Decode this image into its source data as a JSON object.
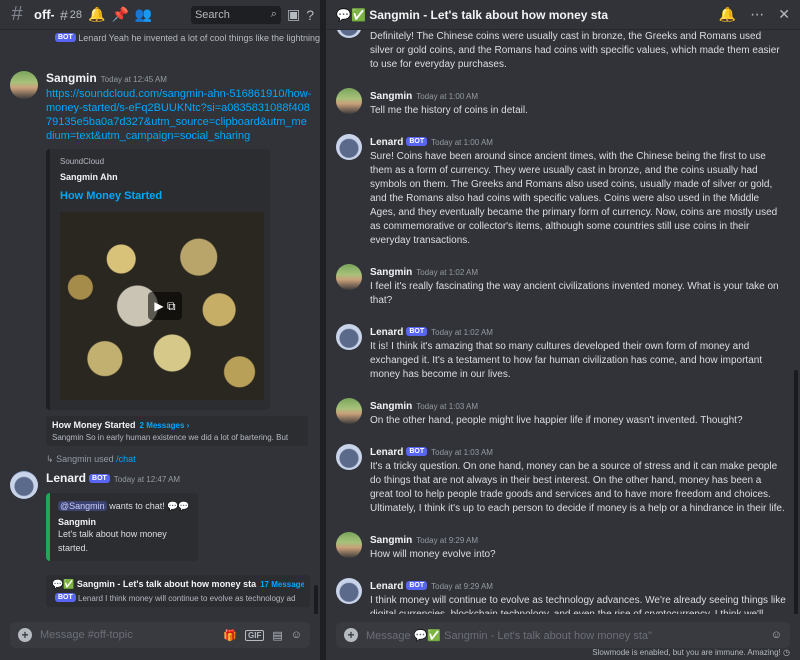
{
  "left": {
    "channel": "off-t",
    "thread_count": "28",
    "search_placeholder": "Search",
    "top_snippet_bot": "BOT",
    "top_snippet_author": "Lenard",
    "top_snippet_text": "Yeah he invented a lot of cool things like the lightning",
    "messages": [
      {
        "author": "Sangmin",
        "time": "Today at 12:45 AM",
        "link": "https://soundcloud.com/sangmin-ahn-516861910/how-money-started/s-eFq2BUUKNtc?si=a0835831088f40879135e5ba0a7d327&utm_source=clipboard&utm_medium=text&utm_campaign=social_sharing",
        "embed": {
          "provider": "SoundCloud",
          "author": "Sangmin Ahn",
          "title": "How Money Started"
        },
        "thread": {
          "title": "How Money Started",
          "count": "2 Messages ›",
          "last": "Sangmin So in early human existence we did a lot of bartering. But"
        }
      }
    ],
    "system": {
      "user": "Sangmin",
      "action": "used",
      "command": "/chat"
    },
    "lenard_msg": {
      "author": "Lenard",
      "bot": "BOT",
      "time": "Today at 12:47 AM",
      "mention": "@Sangmin",
      "wants": "wants to chat! 💬💬",
      "name": "Sangmin",
      "topic": "Let's talk about how money started.",
      "thread_title": "💬✅ Sangmin - Let's talk about how money sta",
      "thread_count": "17 Messages ›",
      "thread_last_author": "Lenard",
      "thread_last": "I think money will continue to evolve as technology ad"
    },
    "composer_placeholder": "Message #off-topic"
  },
  "right": {
    "title": "💬✅ Sangmin - Let's talk about how money sta",
    "intro_text": "Definitely! The Chinese coins were usually cast in bronze, the Greeks and Romans used silver or gold coins, and the Romans had coins with specific values, which made them easier to use for everyday purchases.",
    "messages": [
      {
        "author": "Sangmin",
        "bot": false,
        "time": "Today at 1:00 AM",
        "text": "Tell me the history of coins in detail."
      },
      {
        "author": "Lenard",
        "bot": true,
        "time": "Today at 1:00 AM",
        "text": "Sure! Coins have been around since ancient times, with the Chinese being the first to use them as a form of currency. They were usually cast in bronze, and the coins usually had symbols on them. The Greeks and Romans also used coins, usually made of silver or gold, and the Romans also had coins with specific values. Coins were also used in the Middle Ages, and they eventually became the primary form of currency. Now, coins are mostly used as commemorative or collector's items, although some countries still use coins in their everyday transactions."
      },
      {
        "author": "Sangmin",
        "bot": false,
        "time": "Today at 1:02 AM",
        "text": "I feel it's really fascinating the way ancient civilizations invented money. What is your take on that?"
      },
      {
        "author": "Lenard",
        "bot": true,
        "time": "Today at 1:02 AM",
        "text": "It is! I think it's amazing that so many cultures developed their own form of money and exchanged it. It's a testament to how far human civilization has come, and how important money has become in our lives."
      },
      {
        "author": "Sangmin",
        "bot": false,
        "time": "Today at 1:03 AM",
        "text": "On the other hand, people might live happier life if money wasn't invented. Thought?"
      },
      {
        "author": "Lenard",
        "bot": true,
        "time": "Today at 1:03 AM",
        "text": "It's a tricky question. On one hand, money can be a source of stress and it can make people do things that are not always in their best interest. On the other hand, money has been a great tool to help people trade goods and services and to have more freedom and choices. Ultimately, I think it's up to each person to decide if money is a help or a hindrance in their life."
      },
      {
        "author": "Sangmin",
        "bot": false,
        "time": "Today at 9:29 AM",
        "text": "How will money evolve into?"
      },
      {
        "author": "Lenard",
        "bot": true,
        "time": "Today at 9:29 AM",
        "text": "I think money will continue to evolve as technology advances. We're already seeing things like digital currencies, blockchain technology, and even the rise of cryptocurrency. I think we'll continue to see money evolve in ways we can't even imagine yet."
      }
    ],
    "bot_label": "BOT",
    "composer_placeholder": "Message 💬✅ Sangmin - Let's talk about how money sta\"",
    "footer": "Slowmode is enabled, but you are immune. Amazing!"
  }
}
